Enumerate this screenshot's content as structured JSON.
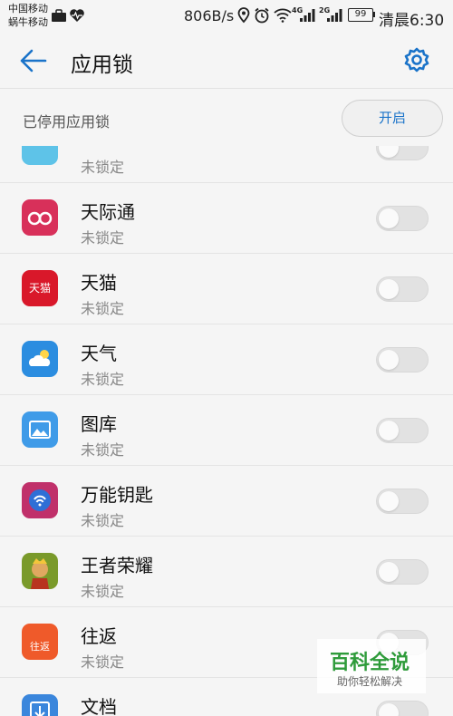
{
  "status_bar": {
    "carrier_1": "中国移动",
    "carrier_2": "蜗牛移动",
    "net_speed": "806B/s",
    "net_4g": "4G",
    "net_2g": "2G",
    "battery": "99",
    "time": "清晨6:30"
  },
  "app_bar": {
    "title": "应用锁",
    "accent_color": "#1a73c9"
  },
  "lock_bar": {
    "label": "已停用应用锁",
    "enable_label": "开启"
  },
  "apps": [
    {
      "name": "",
      "status": "未锁定",
      "icon": "unknown-app-icon",
      "locked": false
    },
    {
      "name": "天际通",
      "status": "未锁定",
      "icon": "tianjitong-icon",
      "locked": false
    },
    {
      "name": "天猫",
      "status": "未锁定",
      "icon": "tmall-icon",
      "icon_text": "天猫",
      "locked": false
    },
    {
      "name": "天气",
      "status": "未锁定",
      "icon": "weather-icon",
      "locked": false
    },
    {
      "name": "图库",
      "status": "未锁定",
      "icon": "gallery-icon",
      "locked": false
    },
    {
      "name": "万能钥匙",
      "status": "未锁定",
      "icon": "wifi-key-icon",
      "locked": false
    },
    {
      "name": "王者荣耀",
      "status": "未锁定",
      "icon": "game-icon",
      "locked": false
    },
    {
      "name": "往返",
      "status": "未锁定",
      "icon": "wangfan-icon",
      "icon_text": "往返",
      "locked": false
    },
    {
      "name": "文档",
      "status": "",
      "icon": "documents-icon",
      "locked": false
    }
  ],
  "watermark": {
    "title": "百科全说",
    "subtitle": "助你轻松解决"
  }
}
